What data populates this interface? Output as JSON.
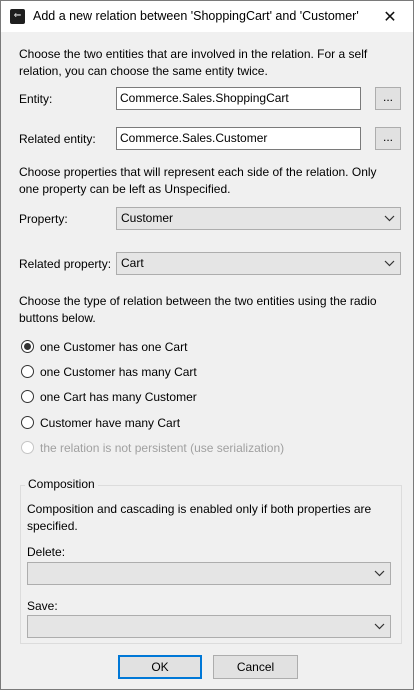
{
  "window": {
    "title": "Add a new relation between 'ShoppingCart' and 'Customer'",
    "close_glyph": "✕",
    "app_icon": "arrow-icon"
  },
  "entities_section": {
    "intro": "Choose the two entities that are involved in the relation. For a self relation, you can choose the same entity twice.",
    "entity_label": "Entity:",
    "entity_value": "Commerce.Sales.ShoppingCart",
    "related_entity_label": "Related entity:",
    "related_entity_value": "Commerce.Sales.Customer",
    "browse_label": "..."
  },
  "properties_section": {
    "intro": "Choose properties that will represent each side of the relation. Only one property can be left as Unspecified.",
    "property_label": "Property:",
    "property_value": "Customer",
    "related_property_label": "Related property:",
    "related_property_value": "Cart"
  },
  "relation_type_section": {
    "intro": "Choose the type of relation between the two entities using the radio buttons below.",
    "options": [
      {
        "label": "one Customer has one Cart",
        "checked": true,
        "enabled": true
      },
      {
        "label": "one Customer has many Cart",
        "checked": false,
        "enabled": true
      },
      {
        "label": "one Cart has many Customer",
        "checked": false,
        "enabled": true
      },
      {
        "label": "Customer have many Cart",
        "checked": false,
        "enabled": true
      },
      {
        "label": "the relation is not persistent (use serialization)",
        "checked": false,
        "enabled": false
      }
    ]
  },
  "composition": {
    "legend": "Composition",
    "description": "Composition and cascading is enabled only if both properties are specified.",
    "delete_label": "Delete:",
    "delete_value": "",
    "save_label": "Save:",
    "save_value": ""
  },
  "buttons": {
    "ok": "OK",
    "cancel": "Cancel"
  },
  "colors": {
    "dialog_background": "#f0f0f0",
    "default_button_border": "#0078d7",
    "disabled_text": "#a0a0a0"
  }
}
